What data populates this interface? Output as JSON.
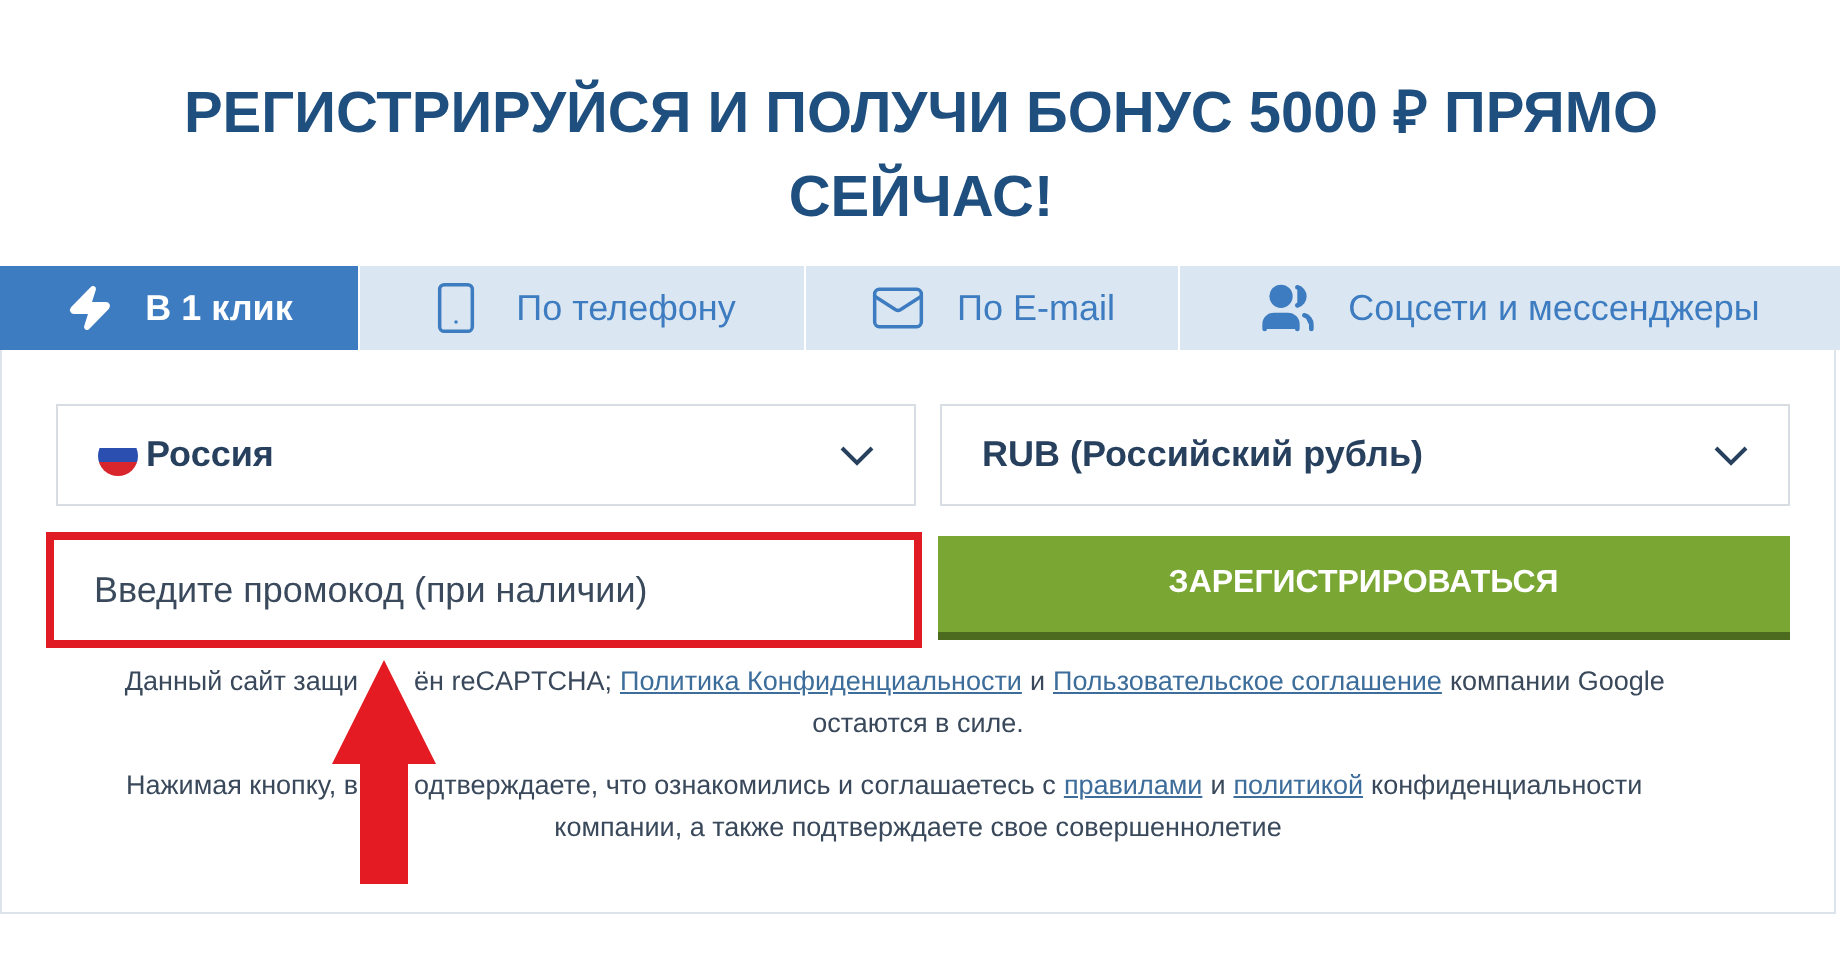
{
  "title": "РЕГИСТРИРУЙСЯ И ПОЛУЧИ БОНУС 5000 ₽ ПРЯМО СЕЙЧАС!",
  "tabs": [
    {
      "label": "В 1 клик",
      "kind": "bolt",
      "selected": true
    },
    {
      "label": "По телефону",
      "kind": "phone",
      "selected": false
    },
    {
      "label": "По E-mail",
      "kind": "mail",
      "selected": false
    },
    {
      "label": "Соцсети и мессенджеры",
      "kind": "people",
      "selected": false
    }
  ],
  "country_select": {
    "value": "Россия"
  },
  "currency_select": {
    "value": "RUB (Российский рубль)"
  },
  "promo_field": {
    "placeholder": "Введите промокод (при наличии)",
    "highlighted": true
  },
  "register_button": {
    "label": "ЗАРЕГИСТРИРОВАТЬСЯ"
  },
  "notes": [
    {
      "before_arrow": "Данный сайт защи",
      "after_arrow": [
        {
          "kind": "text",
          "text": "ён reCAPTCHA;"
        },
        {
          "kind": "link",
          "text": "Политика Конфиденциальности"
        },
        {
          "kind": "text",
          "text": "и"
        },
        {
          "kind": "link",
          "text": "Пользовательское соглашение"
        },
        {
          "kind": "text",
          "text": "компании Google"
        }
      ],
      "next_line": "остаются в силе."
    },
    {
      "before_arrow": "Нажимая кнопку, в",
      "after_arrow": [
        {
          "kind": "text",
          "text": "одтверждаете, что ознакомились и соглашаетесь с"
        },
        {
          "kind": "link",
          "text": "правилами"
        },
        {
          "kind": "text",
          "text": "и"
        },
        {
          "kind": "link",
          "text": "политикой"
        },
        {
          "kind": "text",
          "text": "конфиденциальности"
        }
      ],
      "next_line": "компании, а также подтверждаете свое совершеннолетие"
    }
  ]
}
